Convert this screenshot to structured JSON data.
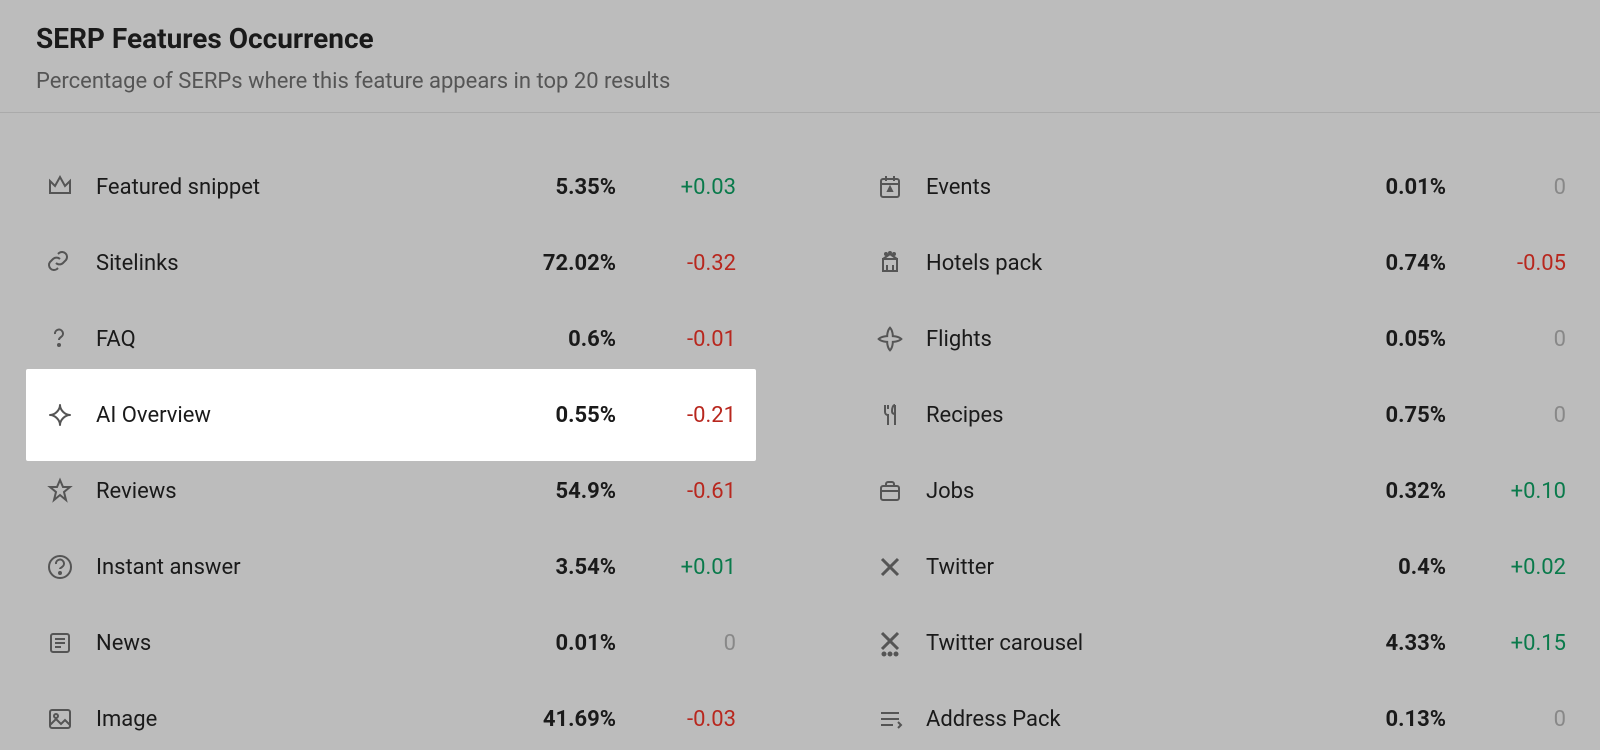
{
  "header": {
    "title": "SERP Features Occurrence",
    "subtitle": "Percentage of SERPs where this feature appears in top 20 results"
  },
  "columns": [
    [
      {
        "icon": "crown",
        "label": "Featured snippet",
        "percent": "5.35%",
        "delta": "+0.03",
        "dir": "pos",
        "highlight": false
      },
      {
        "icon": "link",
        "label": "Sitelinks",
        "percent": "72.02%",
        "delta": "-0.32",
        "dir": "neg",
        "highlight": false
      },
      {
        "icon": "question",
        "label": "FAQ",
        "percent": "0.6%",
        "delta": "-0.01",
        "dir": "neg",
        "highlight": false
      },
      {
        "icon": "sparkle",
        "label": "AI Overview",
        "percent": "0.55%",
        "delta": "-0.21",
        "dir": "neg",
        "highlight": true
      },
      {
        "icon": "star",
        "label": "Reviews",
        "percent": "54.9%",
        "delta": "-0.61",
        "dir": "neg",
        "highlight": false
      },
      {
        "icon": "qcircle",
        "label": "Instant answer",
        "percent": "3.54%",
        "delta": "+0.01",
        "dir": "pos",
        "highlight": false
      },
      {
        "icon": "news",
        "label": "News",
        "percent": "0.01%",
        "delta": "0",
        "dir": "zero",
        "highlight": false
      },
      {
        "icon": "image",
        "label": "Image",
        "percent": "41.69%",
        "delta": "-0.03",
        "dir": "neg",
        "highlight": false
      }
    ],
    [
      {
        "icon": "calendar",
        "label": "Events",
        "percent": "0.01%",
        "delta": "0",
        "dir": "zero",
        "highlight": false
      },
      {
        "icon": "hotel",
        "label": "Hotels pack",
        "percent": "0.74%",
        "delta": "-0.05",
        "dir": "neg",
        "highlight": false
      },
      {
        "icon": "plane",
        "label": "Flights",
        "percent": "0.05%",
        "delta": "0",
        "dir": "zero",
        "highlight": false
      },
      {
        "icon": "fork",
        "label": "Recipes",
        "percent": "0.75%",
        "delta": "0",
        "dir": "zero",
        "highlight": false
      },
      {
        "icon": "briefcase",
        "label": "Jobs",
        "percent": "0.32%",
        "delta": "+0.10",
        "dir": "pos",
        "highlight": false
      },
      {
        "icon": "twitter",
        "label": "Twitter",
        "percent": "0.4%",
        "delta": "+0.02",
        "dir": "pos",
        "highlight": false
      },
      {
        "icon": "twitterc",
        "label": "Twitter carousel",
        "percent": "4.33%",
        "delta": "+0.15",
        "dir": "pos",
        "highlight": false
      },
      {
        "icon": "address",
        "label": "Address Pack",
        "percent": "0.13%",
        "delta": "0",
        "dir": "zero",
        "highlight": false
      }
    ]
  ]
}
